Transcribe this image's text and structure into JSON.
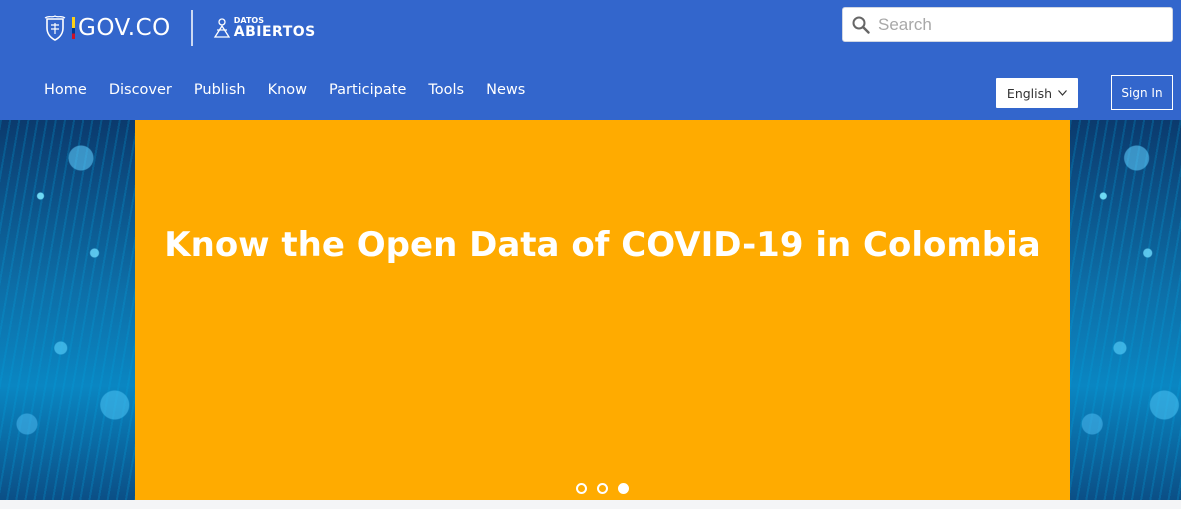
{
  "brand": {
    "govco": "GOV.CO",
    "datos_small": "DATOS",
    "datos_big": "ABIERTOS"
  },
  "search": {
    "placeholder": "Search"
  },
  "nav": {
    "items": [
      "Home",
      "Discover",
      "Publish",
      "Know",
      "Participate",
      "Tools",
      "News"
    ]
  },
  "language": {
    "selected": "English"
  },
  "auth": {
    "sign_in": "Sign In"
  },
  "hero": {
    "title": "Know the Open Data of COVID-19 in Colombia",
    "slide_count": 3,
    "active_slide": 3
  },
  "colors": {
    "header_bg": "#3366cc",
    "hero_panel": "#ffab00",
    "text_on_dark": "#ffffff"
  }
}
